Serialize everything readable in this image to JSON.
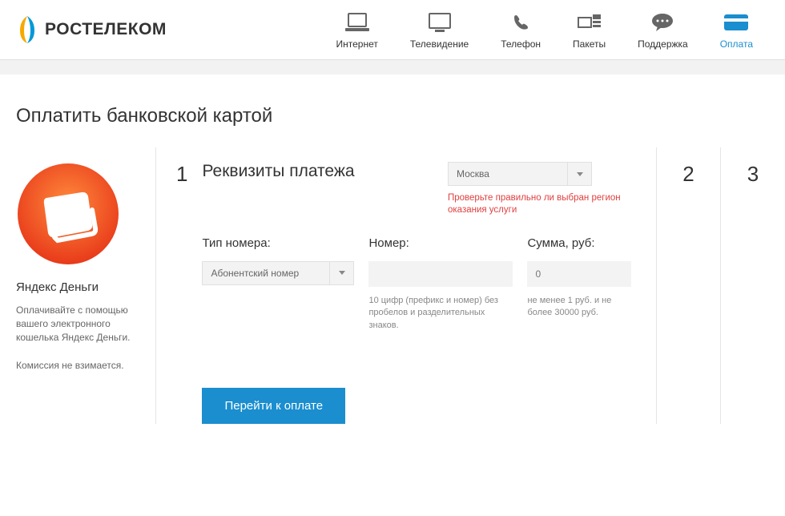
{
  "logo": {
    "text": "РОСТЕЛЕКОМ"
  },
  "nav": {
    "internet": "Интернет",
    "tv": "Телевидение",
    "phone": "Телефон",
    "packages": "Пакеты",
    "support": "Поддержка",
    "payment": "Оплата"
  },
  "page": {
    "title": "Оплатить банковской картой"
  },
  "sidebar": {
    "title": "Яндекс Деньги",
    "desc": "Оплачивайте с помощью вашего электронного кошелька Яндекс Деньги.",
    "note": "Комиссия не взимается."
  },
  "form": {
    "step1_number": "1",
    "step1_title": "Реквизиты платежа",
    "region_selected": "Москва",
    "region_warning": "Проверьте правильно ли выбран регион оказания услуги",
    "type_label": "Тип номера:",
    "type_selected": "Абонентский номер",
    "number_label": "Номер:",
    "number_hint": "10 цифр (префикс и номер) без пробелов и разделительных знаков.",
    "amount_label": "Сумма, руб:",
    "amount_placeholder": "0",
    "amount_hint": "не менее 1 руб. и не более 30000 руб.",
    "submit": "Перейти к оплате",
    "step2_number": "2",
    "step3_number": "3"
  }
}
